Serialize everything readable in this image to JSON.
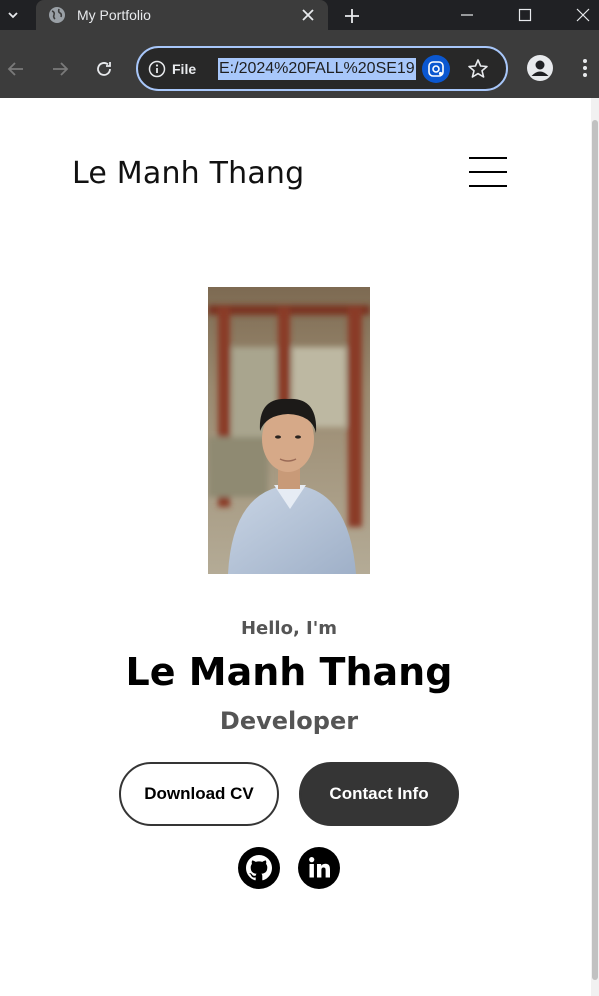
{
  "browser": {
    "tab_title": "My Portfolio",
    "site_info_label": "File",
    "url": "E:/2024%20FALL%20SE19"
  },
  "site": {
    "logo": "Le Manh Thang",
    "greeting": "Hello, I'm",
    "name": "Le Manh Thang",
    "role": "Developer",
    "download_cv_label": "Download CV",
    "contact_info_label": "Contact Info",
    "photo_alt": "Profile picture"
  },
  "colors": {
    "chrome_dark": "#202124",
    "chrome_toolbar": "#3c3c3c",
    "omnibox_border": "#a8c7fa",
    "button_dark": "#353535",
    "text_muted": "#555555"
  },
  "icons": {
    "tab_search": "chevron-down-icon",
    "favicon": "globe-icon",
    "tab_close": "close-icon",
    "new_tab": "plus-icon",
    "back": "arrow-left-icon",
    "forward": "arrow-right-icon",
    "reload": "reload-icon",
    "site_info": "info-icon",
    "lens": "lens-icon",
    "bookmark": "star-icon",
    "profile": "person-icon",
    "browser_menu": "kebab-icon",
    "nav_menu": "hamburger-icon",
    "github": "github-icon",
    "linkedin": "linkedin-icon"
  }
}
